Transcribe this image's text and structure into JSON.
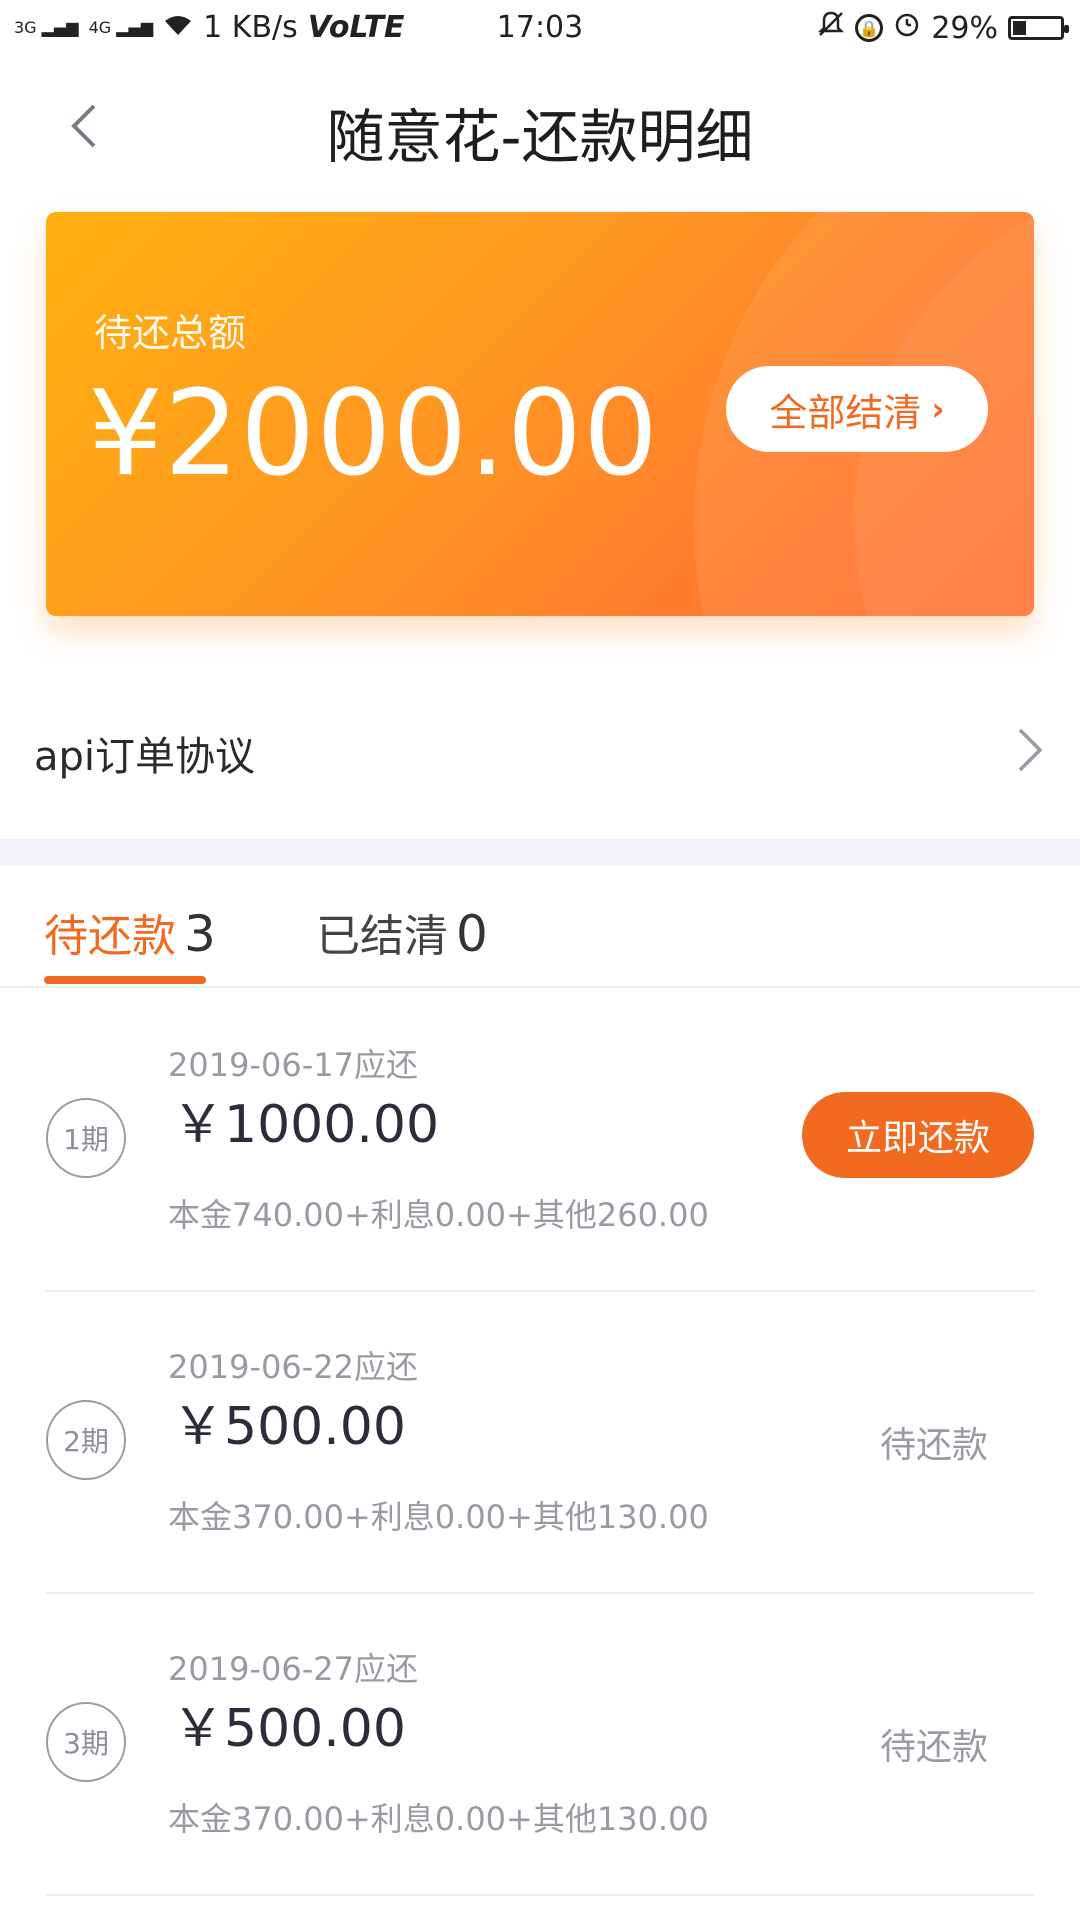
{
  "status_bar": {
    "signal1": "3G",
    "signal2": "4G",
    "speed": "1 KB/s",
    "volte": "VoLTE",
    "time": "17:03",
    "battery": "29%",
    "battery_fraction": 0.29
  },
  "header": {
    "title": "随意花-还款明细"
  },
  "hero": {
    "label": "待还总额",
    "amount": "¥2000.00",
    "settle_button": "全部结清",
    "settle_chevron": "›"
  },
  "agreement": {
    "label": "api订单协议"
  },
  "tabs": [
    {
      "label": "待还款",
      "count": "3"
    },
    {
      "label": "已结清",
      "count": "0"
    }
  ],
  "installments": [
    {
      "period": "1期",
      "due_date": "2019-06-17应还",
      "amount": "￥1000.00",
      "breakdown": "本金740.00+利息0.00+其他260.00",
      "action": "立即还款"
    },
    {
      "period": "2期",
      "due_date": "2019-06-22应还",
      "amount": "￥500.00",
      "breakdown": "本金370.00+利息0.00+其他130.00",
      "status": "待还款"
    },
    {
      "period": "3期",
      "due_date": "2019-06-27应还",
      "amount": "￥500.00",
      "breakdown": "本金370.00+利息0.00+其他130.00",
      "status": "待还款"
    }
  ],
  "colors": {
    "accent": "#f26a1f",
    "card_gradient_start": "#ffb00e",
    "card_gradient_end": "#ff6d2e"
  }
}
